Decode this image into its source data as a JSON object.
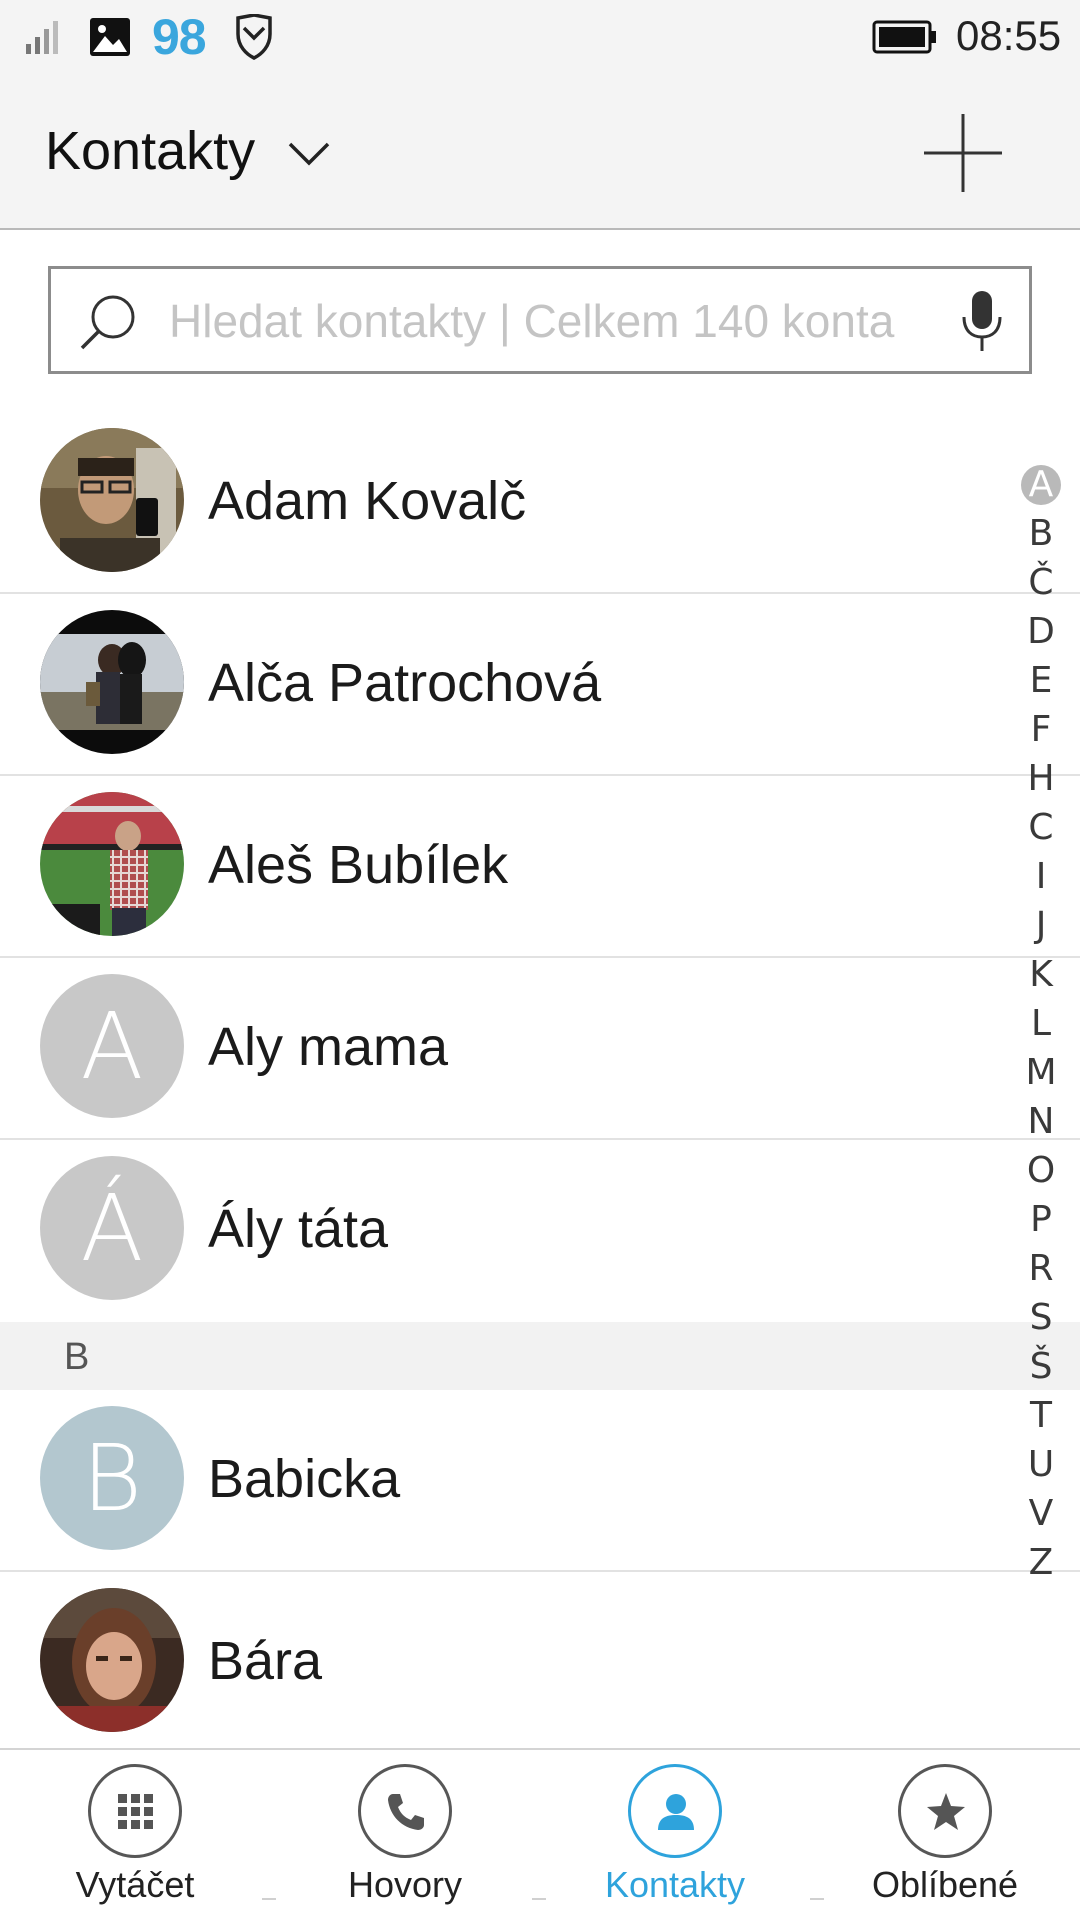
{
  "status_bar": {
    "notification_count": "98",
    "time": "08:55"
  },
  "header": {
    "title": "Kontakty"
  },
  "search": {
    "placeholder": "Hledat kontakty | Celkem 140 konta"
  },
  "contacts_a": [
    {
      "name": "Adam Kovalč",
      "avatar": "photo"
    },
    {
      "name": "Alča Patrochová",
      "avatar": "photo"
    },
    {
      "name": "Aleš Bubílek",
      "avatar": "photo"
    },
    {
      "name": "Aly mama",
      "avatar_letter": "A"
    },
    {
      "name": "Ály táta",
      "avatar_letter": "Á"
    }
  ],
  "section_b": {
    "label": "B"
  },
  "contacts_b": [
    {
      "name": "Babicka",
      "avatar_letter": "B"
    },
    {
      "name": "Bára",
      "avatar": "photo"
    }
  ],
  "alphabet_index": [
    "A",
    "B",
    "Č",
    "D",
    "E",
    "F",
    "H",
    "C",
    "I",
    "J",
    "K",
    "L",
    "M",
    "N",
    "O",
    "P",
    "R",
    "S",
    "Š",
    "T",
    "U",
    "V",
    "Z"
  ],
  "alphabet_active": "A",
  "bottom_nav": [
    {
      "label": "Vytáčet",
      "icon": "dialpad-icon"
    },
    {
      "label": "Hovory",
      "icon": "phone-icon"
    },
    {
      "label": "Kontakty",
      "icon": "person-icon",
      "active": true
    },
    {
      "label": "Oblíbené",
      "icon": "star-icon"
    }
  ],
  "colors": {
    "accent": "#2ea3dc",
    "letter_avatar_gray": "#c8c8c8",
    "letter_avatar_blue": "#b3c7cf"
  }
}
